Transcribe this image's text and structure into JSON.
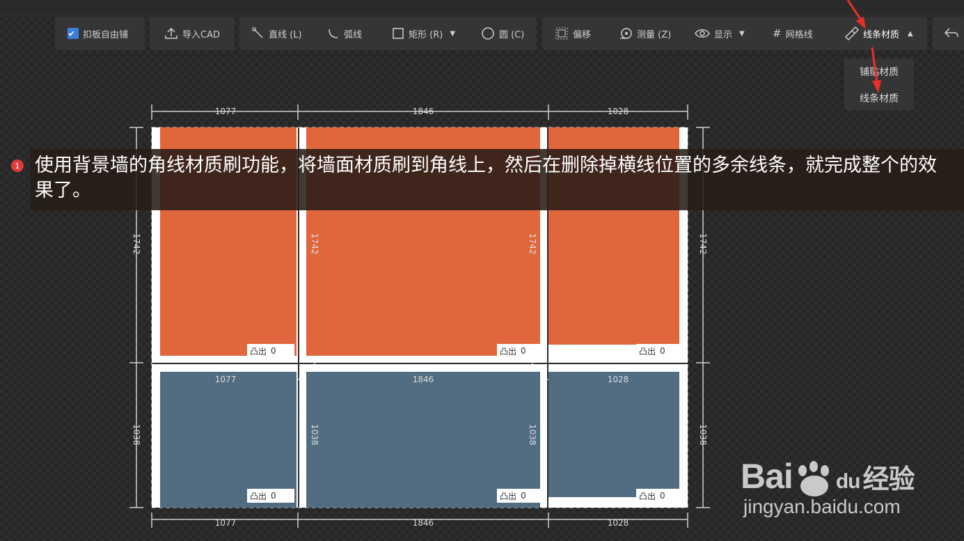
{
  "toolbar": {
    "tile_free": "扣板自由铺",
    "import_cad": "导入CAD",
    "line": "直线 (L)",
    "arc": "弧线",
    "rect": "矩形 (R)",
    "circle": "圆 (C)",
    "offset": "偏移",
    "measure": "测量 (Z)",
    "display": "显示",
    "grid_line": "网格线",
    "line_material": "线条材质"
  },
  "dropdown": {
    "items": [
      "铺贴材质",
      "线条材质"
    ]
  },
  "drawing": {
    "top_dims": [
      "1077",
      "1846",
      "1028"
    ],
    "mid_dims": [
      "1077",
      "1846",
      "1028"
    ],
    "bottom_dims": [
      "1077",
      "1846",
      "1028"
    ],
    "upper_height": "1742",
    "lower_height": "1038",
    "protrude_label": "凸出",
    "protrude_value": "0"
  },
  "caption": {
    "step": "1",
    "text": "使用背景墙的角线材质刷功能，将墙面材质刷到角线上，然后在删除掉横线位置的多余线条，就完成整个的效果了。"
  },
  "watermark": {
    "logo_a": "Bai",
    "logo_b": "du",
    "logo_c": "经验",
    "url": "jingyan.baidu.com"
  },
  "colors": {
    "accent": "#3b7ddd",
    "orange_panel": "#e0673c",
    "blue_panel": "#4e6a80",
    "arrow": "#e8302a"
  }
}
